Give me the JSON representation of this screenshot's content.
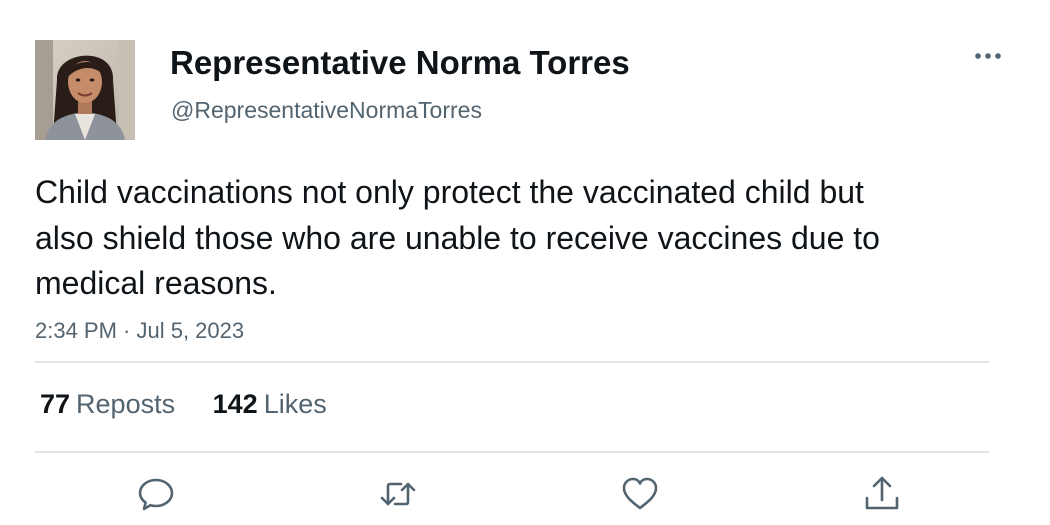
{
  "author": {
    "display_name": "Representative Norma Torres",
    "handle": "@RepresentativeNormaTorres",
    "avatar_icon": "profile-photo"
  },
  "tweet": {
    "text": "Child vaccinations not only protect the vaccinated child but also shield those who are unable to receive vaccines due to medical reasons.",
    "timestamp": "2:34 PM · Jul 5, 2023"
  },
  "stats": {
    "reposts_count": "77",
    "reposts_label": "Reposts",
    "likes_count": "142",
    "likes_label": "Likes"
  },
  "actions": [
    {
      "name": "reply",
      "icon": "reply-icon"
    },
    {
      "name": "repost",
      "icon": "repost-icon"
    },
    {
      "name": "like",
      "icon": "heart-icon"
    },
    {
      "name": "share",
      "icon": "share-icon"
    }
  ],
  "colors": {
    "text_primary": "#0f1419",
    "text_secondary": "#536471",
    "divider": "#e3e6e8",
    "background": "#ffffff"
  }
}
